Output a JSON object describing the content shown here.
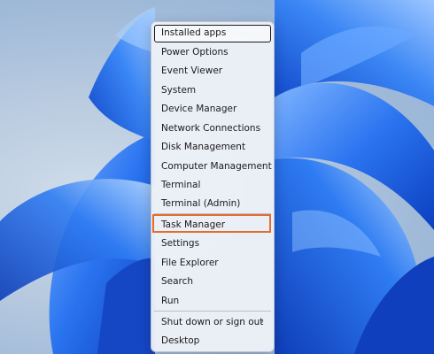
{
  "menu": {
    "items": [
      {
        "label": "Installed apps"
      },
      {
        "label": "Power Options"
      },
      {
        "label": "Event Viewer"
      },
      {
        "label": "System"
      },
      {
        "label": "Device Manager"
      },
      {
        "label": "Network Connections"
      },
      {
        "label": "Disk Management"
      },
      {
        "label": "Computer Management"
      },
      {
        "label": "Terminal"
      },
      {
        "label": "Terminal (Admin)"
      },
      {
        "label": "Task Manager"
      },
      {
        "label": "Settings"
      },
      {
        "label": "File Explorer"
      },
      {
        "label": "Search"
      },
      {
        "label": "Run"
      },
      {
        "label": "Shut down or sign out"
      },
      {
        "label": "Desktop"
      }
    ],
    "focused_item": "Installed apps",
    "highlighted_item": "Task Manager",
    "submenu_icon": "chevron-right-icon"
  },
  "colors": {
    "highlight_border": "#e46c2f",
    "wallpaper_blue": "#1f6fe5"
  }
}
